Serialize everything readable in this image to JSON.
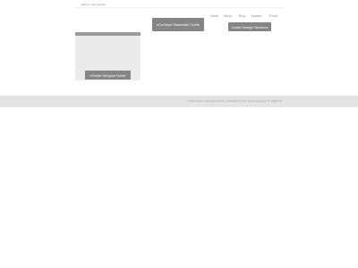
{
  "header": {
    "skip_link": "Skip to main content"
  },
  "nav": {
    "items": [
      {
        "label": "Home"
      },
      {
        "label": "About"
      },
      {
        "label": "Blog"
      },
      {
        "label": "Contact"
      },
      {
        "label": "Portal"
      }
    ]
  },
  "buttons": {
    "contract": "eContract Stackable Guide",
    "design": "Guide Design Services",
    "surgical": "eGuide Surgical Guide"
  },
  "footer": {
    "text": "© 2023 Guide to the Dental Systems · Stackable Portfolio, 4th Ave Anywhere, PL 10000 USA"
  }
}
